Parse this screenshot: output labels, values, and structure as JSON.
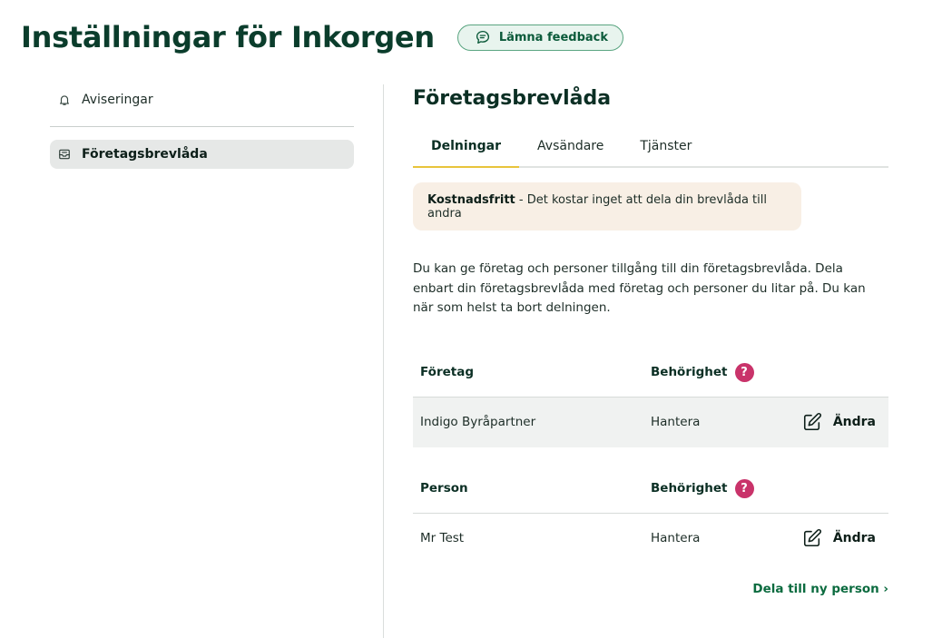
{
  "header": {
    "title": "Inställningar för Inkorgen",
    "feedback_label": "Lämna feedback"
  },
  "sidebar": {
    "items": [
      {
        "label": "Aviseringar",
        "icon": "bell-icon"
      },
      {
        "label": "Företagsbrevlåda",
        "icon": "inbox-icon",
        "active": true
      }
    ]
  },
  "main": {
    "title": "Företagsbrevlåda",
    "tabs": [
      {
        "label": "Delningar",
        "active": true
      },
      {
        "label": "Avsändare"
      },
      {
        "label": "Tjänster"
      }
    ],
    "notice": {
      "bold": "Kostnadsfritt",
      "text": " - Det kostar inget att dela din brevlåda till andra"
    },
    "description": "Du kan ge företag och personer tillgång till din företagsbrevlåda. Dela enbart din företagsbrevlåda med företag och personer du litar på. Du kan när som helst ta bort delningen.",
    "company_table": {
      "headers": {
        "name": "Företag",
        "permission": "Behörighet"
      },
      "rows": [
        {
          "name": "Indigo Byråpartner",
          "permission": "Hantera",
          "action": "Ändra"
        }
      ]
    },
    "person_table": {
      "headers": {
        "name": "Person",
        "permission": "Behörighet"
      },
      "rows": [
        {
          "name": "Mr Test",
          "permission": "Hantera",
          "action": "Ändra"
        }
      ]
    },
    "help_glyph": "?",
    "share_link": "Dela till ny person ›"
  },
  "colors": {
    "brand_dark": "#0b3d2c",
    "accent_green": "#0b6b3f",
    "tab_underline": "#e8c43c",
    "help_badge": "#c9336a",
    "notice_bg": "#f8efe5"
  }
}
